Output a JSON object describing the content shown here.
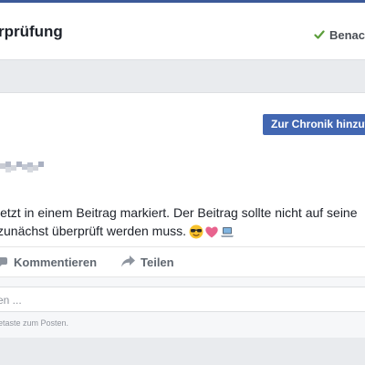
{
  "header": {
    "title": "rprüfung",
    "notify_label": "Benac",
    "check_icon": "check-icon",
    "accent": "#3b5998"
  },
  "post": {
    "timeline_button_label": "Zur Chronik hinzuf",
    "text_line_1": "jetzt in einem Beitrag markiert. Der Beitrag sollte nicht auf seine",
    "text_line_2": "zunächst überprüft werden muss.",
    "emojis": [
      "sunglasses-face-emoji",
      "pink-heart-emoji",
      "laptop-emoji"
    ],
    "actions": [
      {
        "label": "Kommentieren",
        "icon": "comment-icon"
      },
      {
        "label": "Teilen",
        "icon": "share-arrow-icon"
      }
    ],
    "comment": {
      "placeholder": "en ...",
      "hint": "etaste zum Posten."
    },
    "button_color": "#4267b2"
  }
}
